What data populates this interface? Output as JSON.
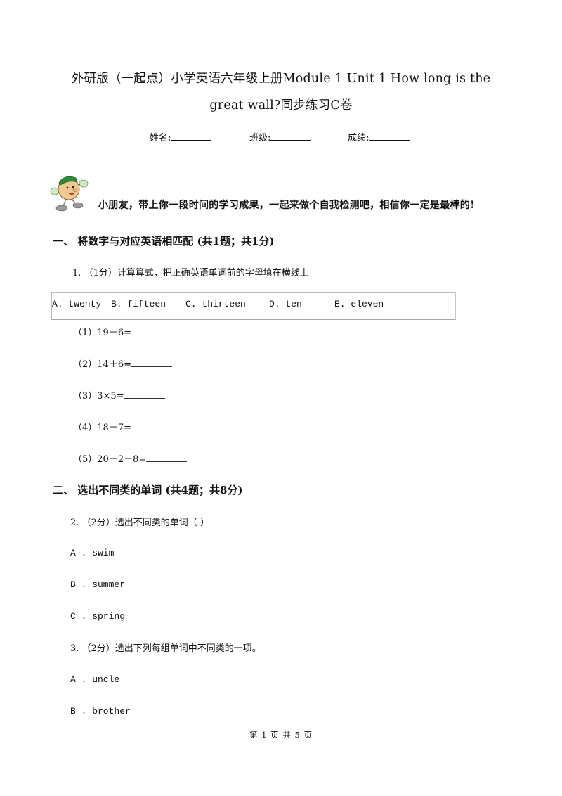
{
  "header": {
    "title_line1": "外研版（一起点）小学英语六年级上册Module 1 Unit 1 How long is the",
    "title_line2": "great wall?同步练习C卷",
    "fields": [
      {
        "label": "姓名:"
      },
      {
        "label": "班级:"
      },
      {
        "label": "成绩:"
      }
    ]
  },
  "intro": {
    "mascot_icon": "cartoon-boy-mascot",
    "text": "小朋友，带上你一段时间的学习成果，一起来做个自我检测吧，相信你一定是最棒的!"
  },
  "sections": [
    {
      "heading": "一、  将数字与对应英语相匹配 (共1题；共1分)",
      "questions": [
        {
          "stem": "1.  （1分）计算算式，把正确英语单词前的字母填在横线上",
          "word_bank": [
            "A. twenty",
            "B. fifteen",
            "C. thirteen",
            "D. ten",
            "E. eleven"
          ],
          "items": [
            "（1）19－6=",
            "（2）14＋6=",
            "（3）3×5=",
            "（4）18－7=",
            "（5）20－2－8="
          ]
        }
      ]
    },
    {
      "heading": "二、  选出不同类的单词 (共4题；共8分)",
      "questions": [
        {
          "stem": "2.  （2分）选出不同类的单词（      ）",
          "options": [
            "A . swim",
            "B . summer",
            "C . spring"
          ]
        },
        {
          "stem": "3.  （2分）选出下列每组单词中不同类的一项。",
          "options": [
            "A . uncle",
            "B . brother"
          ]
        }
      ]
    }
  ],
  "footer": {
    "page_label": "第 1 页 共 5 页"
  }
}
